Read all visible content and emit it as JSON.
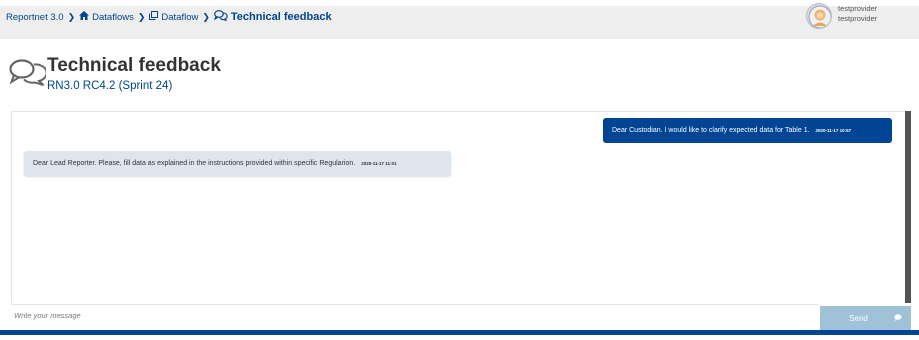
{
  "breadcrumb": {
    "items": [
      {
        "label": "Reportnet 3.0"
      },
      {
        "label": "Dataflows"
      },
      {
        "label": "Dataflow"
      },
      {
        "label": "Technical feedback"
      }
    ]
  },
  "user": {
    "line1": "testprovider",
    "line2": "testprovider"
  },
  "page": {
    "title": "Technical feedback",
    "subtitle": "RN3.0 RC4.2 (Sprint 24)"
  },
  "messages": [
    {
      "text": "Dear Custodian. I would like to clarify expected data for Table 1.",
      "timestamp": "2020-11-17 10:57",
      "direction": "outgoing"
    },
    {
      "text": "Dear Lead Reporter. Please, fill data as explained in the instructions provided within specific Regularion.",
      "timestamp": "2020-11-17 11:01",
      "direction": "incoming"
    }
  ],
  "composer": {
    "placeholder": "Write your message",
    "send_label": "Send"
  },
  "colors": {
    "primary": "#004494",
    "topbar_bg": "#eeeeee",
    "incoming_bubble": "#dfe5ef",
    "send_button": "#9fc2d6"
  }
}
